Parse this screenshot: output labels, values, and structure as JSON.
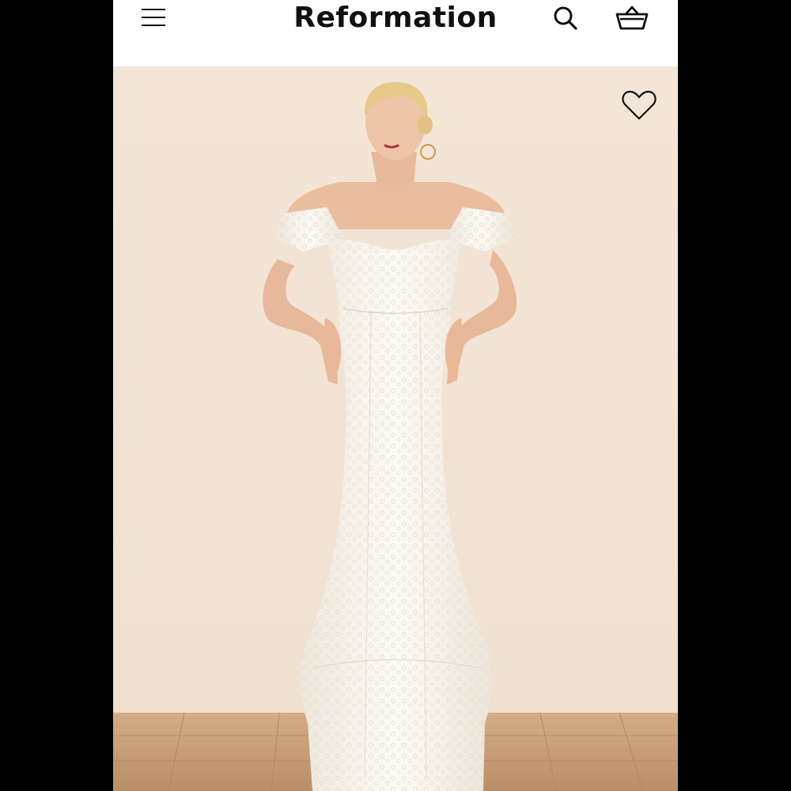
{
  "header": {
    "brand": "Reformation",
    "icons": {
      "menu": "menu-icon",
      "search": "search-icon",
      "bag": "shopping-basket-icon"
    }
  },
  "product": {
    "image": "product-photo-white-lace-off-shoulder-gown",
    "favorite_icon": "heart-outline-icon"
  },
  "colors": {
    "backdrop": "#f2e4d4",
    "floor": "#c9a27b",
    "dress": "#fbf8f3",
    "frame": "#000000"
  }
}
